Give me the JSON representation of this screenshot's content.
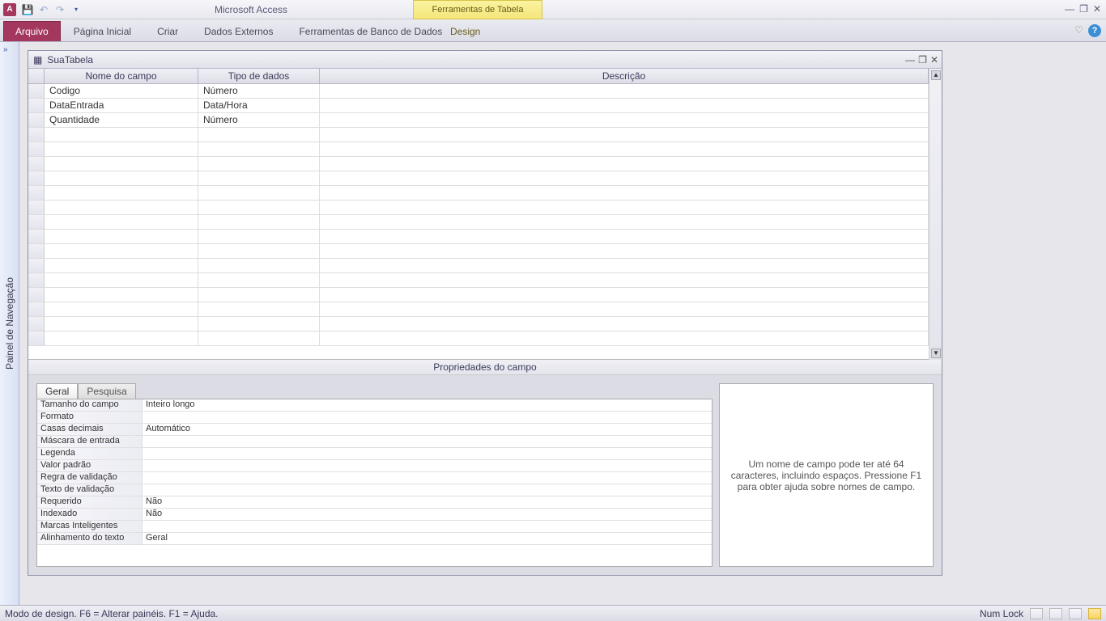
{
  "app_title": "Microsoft Access",
  "context_tab_title": "Ferramentas de Tabela",
  "ribbon": {
    "file": "Arquivo",
    "home": "Página Inicial",
    "create": "Criar",
    "external": "Dados Externos",
    "dbtools": "Ferramentas de Banco de Dados",
    "design": "Design"
  },
  "navpane_label": "Painel de Navegação",
  "table_name": "SuaTabela",
  "grid_headers": {
    "name": "Nome do campo",
    "type": "Tipo de dados",
    "desc": "Descrição"
  },
  "rows": [
    {
      "name": "Codigo",
      "type": "Número",
      "desc": ""
    },
    {
      "name": "DataEntrada",
      "type": "Data/Hora",
      "desc": ""
    },
    {
      "name": "Quantidade",
      "type": "Número",
      "desc": ""
    }
  ],
  "props_title": "Propriedades do campo",
  "ptabs": {
    "general": "Geral",
    "lookup": "Pesquisa"
  },
  "props": [
    {
      "label": "Tamanho do campo",
      "value": "Inteiro longo"
    },
    {
      "label": "Formato",
      "value": ""
    },
    {
      "label": "Casas decimais",
      "value": "Automático"
    },
    {
      "label": "Máscara de entrada",
      "value": ""
    },
    {
      "label": "Legenda",
      "value": ""
    },
    {
      "label": "Valor padrão",
      "value": ""
    },
    {
      "label": "Regra de validação",
      "value": ""
    },
    {
      "label": "Texto de validação",
      "value": ""
    },
    {
      "label": "Requerido",
      "value": "Não"
    },
    {
      "label": "Indexado",
      "value": "Não"
    },
    {
      "label": "Marcas Inteligentes",
      "value": ""
    },
    {
      "label": "Alinhamento do texto",
      "value": "Geral"
    }
  ],
  "help_text": "Um nome de campo pode ter até 64 caracteres, incluindo espaços. Pressione F1 para obter ajuda sobre nomes de campo.",
  "status_text": "Modo de design. F6 = Alterar painéis. F1 = Ajuda.",
  "numlock": "Num Lock"
}
